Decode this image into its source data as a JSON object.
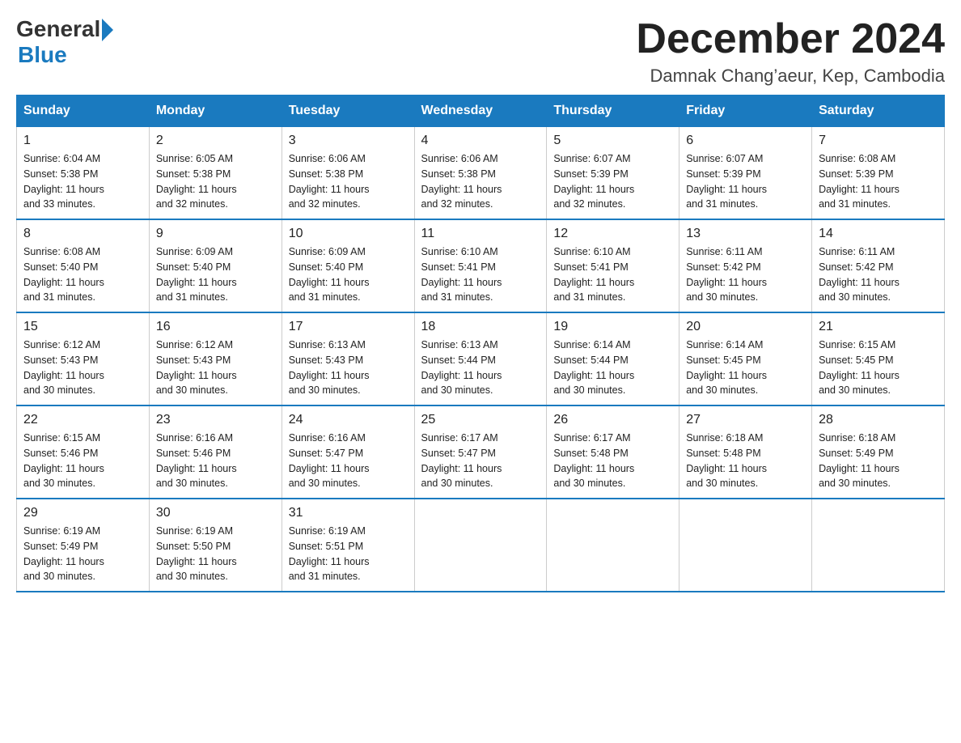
{
  "header": {
    "logo_general": "General",
    "logo_blue": "Blue",
    "month_title": "December 2024",
    "location": "Damnak Chang’aeur, Kep, Cambodia"
  },
  "weekdays": [
    "Sunday",
    "Monday",
    "Tuesday",
    "Wednesday",
    "Thursday",
    "Friday",
    "Saturday"
  ],
  "weeks": [
    [
      {
        "day": "1",
        "sunrise": "6:04 AM",
        "sunset": "5:38 PM",
        "daylight": "11 hours and 33 minutes."
      },
      {
        "day": "2",
        "sunrise": "6:05 AM",
        "sunset": "5:38 PM",
        "daylight": "11 hours and 32 minutes."
      },
      {
        "day": "3",
        "sunrise": "6:06 AM",
        "sunset": "5:38 PM",
        "daylight": "11 hours and 32 minutes."
      },
      {
        "day": "4",
        "sunrise": "6:06 AM",
        "sunset": "5:38 PM",
        "daylight": "11 hours and 32 minutes."
      },
      {
        "day": "5",
        "sunrise": "6:07 AM",
        "sunset": "5:39 PM",
        "daylight": "11 hours and 32 minutes."
      },
      {
        "day": "6",
        "sunrise": "6:07 AM",
        "sunset": "5:39 PM",
        "daylight": "11 hours and 31 minutes."
      },
      {
        "day": "7",
        "sunrise": "6:08 AM",
        "sunset": "5:39 PM",
        "daylight": "11 hours and 31 minutes."
      }
    ],
    [
      {
        "day": "8",
        "sunrise": "6:08 AM",
        "sunset": "5:40 PM",
        "daylight": "11 hours and 31 minutes."
      },
      {
        "day": "9",
        "sunrise": "6:09 AM",
        "sunset": "5:40 PM",
        "daylight": "11 hours and 31 minutes."
      },
      {
        "day": "10",
        "sunrise": "6:09 AM",
        "sunset": "5:40 PM",
        "daylight": "11 hours and 31 minutes."
      },
      {
        "day": "11",
        "sunrise": "6:10 AM",
        "sunset": "5:41 PM",
        "daylight": "11 hours and 31 minutes."
      },
      {
        "day": "12",
        "sunrise": "6:10 AM",
        "sunset": "5:41 PM",
        "daylight": "11 hours and 31 minutes."
      },
      {
        "day": "13",
        "sunrise": "6:11 AM",
        "sunset": "5:42 PM",
        "daylight": "11 hours and 30 minutes."
      },
      {
        "day": "14",
        "sunrise": "6:11 AM",
        "sunset": "5:42 PM",
        "daylight": "11 hours and 30 minutes."
      }
    ],
    [
      {
        "day": "15",
        "sunrise": "6:12 AM",
        "sunset": "5:43 PM",
        "daylight": "11 hours and 30 minutes."
      },
      {
        "day": "16",
        "sunrise": "6:12 AM",
        "sunset": "5:43 PM",
        "daylight": "11 hours and 30 minutes."
      },
      {
        "day": "17",
        "sunrise": "6:13 AM",
        "sunset": "5:43 PM",
        "daylight": "11 hours and 30 minutes."
      },
      {
        "day": "18",
        "sunrise": "6:13 AM",
        "sunset": "5:44 PM",
        "daylight": "11 hours and 30 minutes."
      },
      {
        "day": "19",
        "sunrise": "6:14 AM",
        "sunset": "5:44 PM",
        "daylight": "11 hours and 30 minutes."
      },
      {
        "day": "20",
        "sunrise": "6:14 AM",
        "sunset": "5:45 PM",
        "daylight": "11 hours and 30 minutes."
      },
      {
        "day": "21",
        "sunrise": "6:15 AM",
        "sunset": "5:45 PM",
        "daylight": "11 hours and 30 minutes."
      }
    ],
    [
      {
        "day": "22",
        "sunrise": "6:15 AM",
        "sunset": "5:46 PM",
        "daylight": "11 hours and 30 minutes."
      },
      {
        "day": "23",
        "sunrise": "6:16 AM",
        "sunset": "5:46 PM",
        "daylight": "11 hours and 30 minutes."
      },
      {
        "day": "24",
        "sunrise": "6:16 AM",
        "sunset": "5:47 PM",
        "daylight": "11 hours and 30 minutes."
      },
      {
        "day": "25",
        "sunrise": "6:17 AM",
        "sunset": "5:47 PM",
        "daylight": "11 hours and 30 minutes."
      },
      {
        "day": "26",
        "sunrise": "6:17 AM",
        "sunset": "5:48 PM",
        "daylight": "11 hours and 30 minutes."
      },
      {
        "day": "27",
        "sunrise": "6:18 AM",
        "sunset": "5:48 PM",
        "daylight": "11 hours and 30 minutes."
      },
      {
        "day": "28",
        "sunrise": "6:18 AM",
        "sunset": "5:49 PM",
        "daylight": "11 hours and 30 minutes."
      }
    ],
    [
      {
        "day": "29",
        "sunrise": "6:19 AM",
        "sunset": "5:49 PM",
        "daylight": "11 hours and 30 minutes."
      },
      {
        "day": "30",
        "sunrise": "6:19 AM",
        "sunset": "5:50 PM",
        "daylight": "11 hours and 30 minutes."
      },
      {
        "day": "31",
        "sunrise": "6:19 AM",
        "sunset": "5:51 PM",
        "daylight": "11 hours and 31 minutes."
      },
      null,
      null,
      null,
      null
    ]
  ],
  "labels": {
    "sunrise": "Sunrise:",
    "sunset": "Sunset:",
    "daylight": "Daylight:"
  }
}
